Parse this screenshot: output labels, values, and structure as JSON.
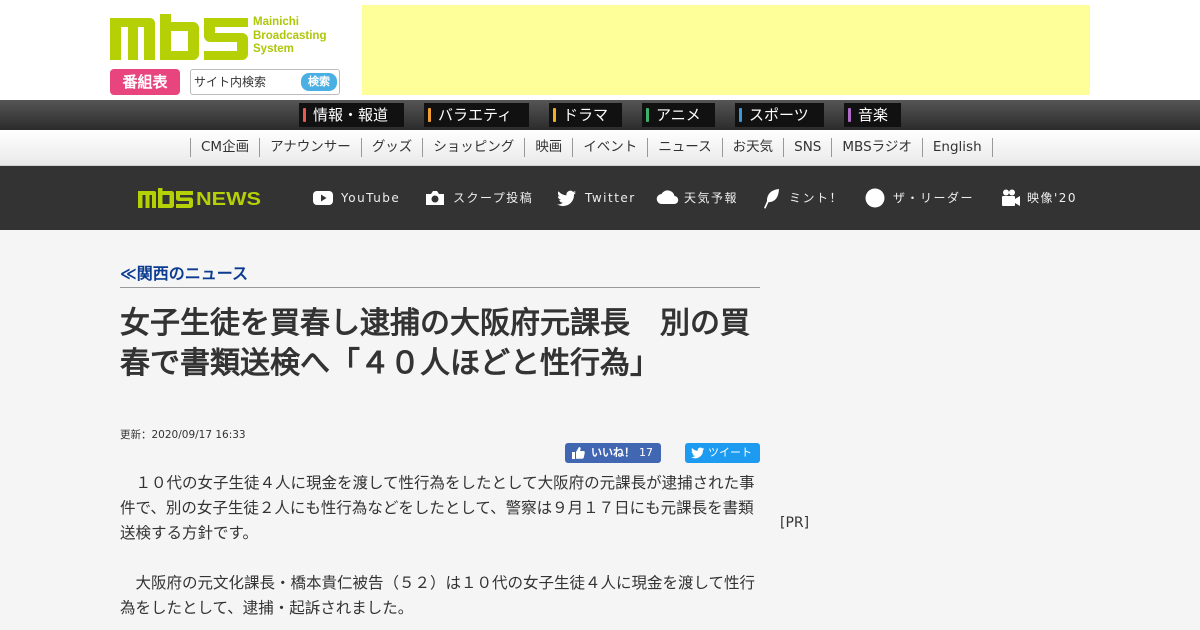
{
  "header": {
    "logo_text": "MBS",
    "logo_sub": [
      "Mainichi",
      "Broadcasting",
      "System"
    ],
    "tv_schedule": "番組表",
    "search_placeholder": "サイト内検索",
    "search_button": "検索"
  },
  "genres": [
    {
      "label": "情報・報道",
      "color": "#e85a4f"
    },
    {
      "label": "バラエティ",
      "color": "#f0a030"
    },
    {
      "label": "ドラマ",
      "color": "#f0b020"
    },
    {
      "label": "アニメ",
      "color": "#3db06a"
    },
    {
      "label": "スポーツ",
      "color": "#3a9ad9"
    },
    {
      "label": "音楽",
      "color": "#b06ac8"
    }
  ],
  "subnav": [
    "CM企画",
    "アナウンサー",
    "グッズ",
    "ショッピング",
    "映画",
    "イベント",
    "ニュース",
    "お天気",
    "SNS",
    "MBSラジオ",
    "English"
  ],
  "newsbar": {
    "logo": "MBSNEWS",
    "items": [
      "YouTube",
      "スクープ投稿",
      "Twitter",
      "天気予報",
      "ミント！",
      "ザ・リーダー",
      "映像'20"
    ]
  },
  "article": {
    "breadcrumb": "≪関西のニュース",
    "title": "女子生徒を買春し逮捕の大阪府元課長　別の買春で書類送検へ「４０人ほどと性行為」",
    "updated": "更新：2020/09/17 16:33",
    "like_label": "いいね！",
    "like_count": "17",
    "tweet_label": "ツイート",
    "paragraphs": [
      "　１０代の女子生徒４人に現金を渡して性行為をしたとして大阪府の元課長が逮捕された事件で、別の女子生徒２人にも性行為などをしたとして、警察は９月１７日にも元課長を書類送検する方針です。",
      "　大阪府の元文化課長・橋本貴仁被告（５２）は１０代の女子生徒４人に現金を渡して性行為をしたとして、逮捕・起訴されました。"
    ]
  },
  "sidebar": {
    "pr": "[PR]"
  },
  "colors": {
    "brand_green": "#b5d005",
    "news_bar": "#333333",
    "ad_bg": "#ffff99",
    "link_blue": "#0b3c91"
  }
}
